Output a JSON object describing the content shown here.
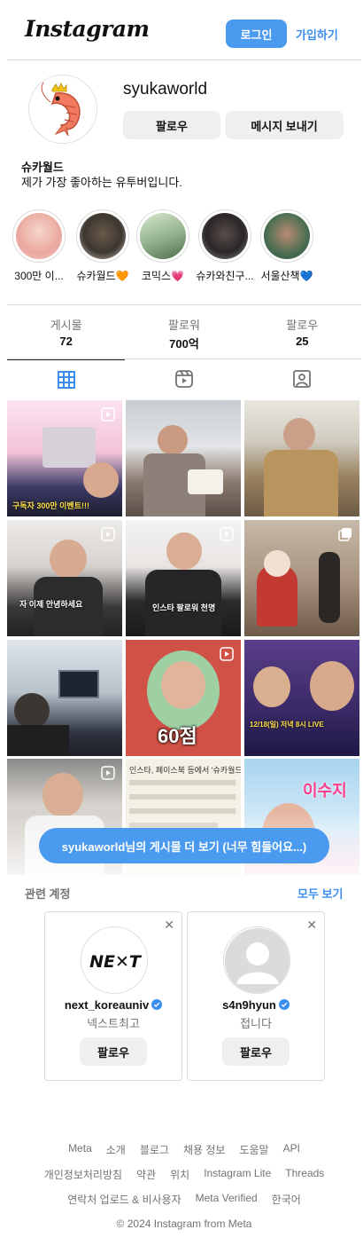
{
  "header": {
    "logo": "Instagram",
    "login_label": "로그인",
    "join_label": "가입하기"
  },
  "profile": {
    "username": "syukaworld",
    "follow_label": "팔로우",
    "message_label": "메시지 보내기",
    "display_name": "슈카월드",
    "bio": "제가 가장 좋아하는 유투버입니다."
  },
  "highlights": [
    {
      "label": "300만 이..."
    },
    {
      "label": "슈카월드🧡"
    },
    {
      "label": "코믹스💗"
    },
    {
      "label": "슈카와친구..."
    },
    {
      "label": "서울산책💙"
    }
  ],
  "stats": [
    {
      "label": "게시물",
      "value": "72"
    },
    {
      "label": "팔로워",
      "value": "700억"
    },
    {
      "label": "팔로우",
      "value": "25"
    }
  ],
  "posts": [
    {
      "caption": "구독자 300만 이벤트!!!",
      "badge": "reel"
    },
    {
      "caption": "",
      "badge": ""
    },
    {
      "caption": "",
      "badge": ""
    },
    {
      "caption": "자 이제 안녕하세요",
      "badge": "reel"
    },
    {
      "caption": "인스타 팔로워 천명",
      "badge": "reel"
    },
    {
      "caption": "",
      "badge": "carousel"
    },
    {
      "caption": "",
      "badge": ""
    },
    {
      "caption": "60점",
      "badge": "reel"
    },
    {
      "caption": "12/18(일) 저녁 8시 LIVE",
      "badge": ""
    },
    {
      "caption": "",
      "badge": "reel"
    },
    {
      "caption": "인스타, 페이스북 등에서 '슈카월드'",
      "badge": ""
    },
    {
      "caption": "이수지",
      "badge": ""
    }
  ],
  "more_button": "syukaworld님의 게시물 더 보기 (너무 힘들어요...)",
  "related": {
    "title": "관련 계정",
    "see_all": "모두 보기",
    "accounts": [
      {
        "username": "next_koreauniv",
        "subtitle": "넥스트최고",
        "follow_label": "팔로우",
        "logo_text": "NE✕T"
      },
      {
        "username": "s4n9hyun",
        "subtitle": "접니다",
        "follow_label": "팔로우"
      }
    ]
  },
  "footer": {
    "row1": [
      "Meta",
      "소개",
      "블로그",
      "채용 정보",
      "도움말",
      "API"
    ],
    "row2": [
      "개인정보처리방침",
      "약관",
      "위치",
      "Instagram Lite",
      "Threads"
    ],
    "row3": [
      "연락처 업로드 & 비사용자",
      "Meta Verified",
      "한국어"
    ],
    "copyright": "© 2024 Instagram from Meta"
  },
  "colors": {
    "accent": "#4a9af0",
    "link": "#3b8ef0",
    "verified": "#3b8ef0"
  }
}
